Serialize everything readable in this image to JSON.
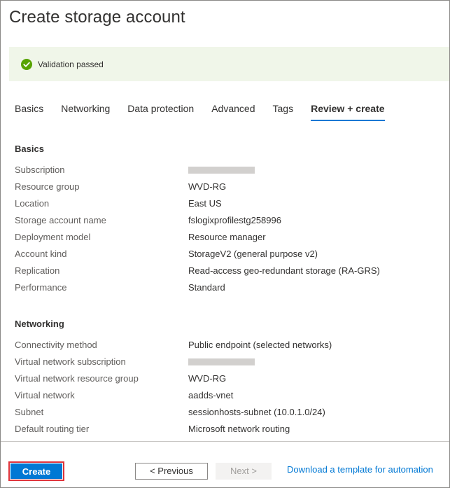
{
  "page": {
    "title": "Create storage account"
  },
  "validation": {
    "text": "Validation passed",
    "status_color": "#57a300",
    "background": "#f0f6e9"
  },
  "tabs": [
    {
      "label": "Basics",
      "active": false
    },
    {
      "label": "Networking",
      "active": false
    },
    {
      "label": "Data protection",
      "active": false
    },
    {
      "label": "Advanced",
      "active": false
    },
    {
      "label": "Tags",
      "active": false
    },
    {
      "label": "Review + create",
      "active": true
    }
  ],
  "basics": {
    "title": "Basics",
    "rows": [
      {
        "label": "Subscription",
        "value": null
      },
      {
        "label": "Resource group",
        "value": "WVD-RG"
      },
      {
        "label": "Location",
        "value": "East US"
      },
      {
        "label": "Storage account name",
        "value": "fslogixprofilestg258996"
      },
      {
        "label": "Deployment model",
        "value": "Resource manager"
      },
      {
        "label": "Account kind",
        "value": "StorageV2 (general purpose v2)"
      },
      {
        "label": "Replication",
        "value": "Read-access geo-redundant storage (RA-GRS)"
      },
      {
        "label": "Performance",
        "value": "Standard"
      }
    ]
  },
  "networking": {
    "title": "Networking",
    "rows": [
      {
        "label": "Connectivity method",
        "value": "Public endpoint (selected networks)"
      },
      {
        "label": "Virtual network subscription",
        "value": null
      },
      {
        "label": "Virtual network resource group",
        "value": "WVD-RG"
      },
      {
        "label": "Virtual network",
        "value": "aadds-vnet"
      },
      {
        "label": "Subnet",
        "value": "sessionhosts-subnet (10.0.1.0/24)"
      },
      {
        "label": "Default routing tier",
        "value": "Microsoft network routing"
      }
    ]
  },
  "footer": {
    "create_label": "Create",
    "previous_label": "< Previous",
    "next_label": "Next >",
    "download_label": "Download a template for automation"
  },
  "colors": {
    "accent": "#0078d4",
    "highlight_border": "#e0343b"
  }
}
